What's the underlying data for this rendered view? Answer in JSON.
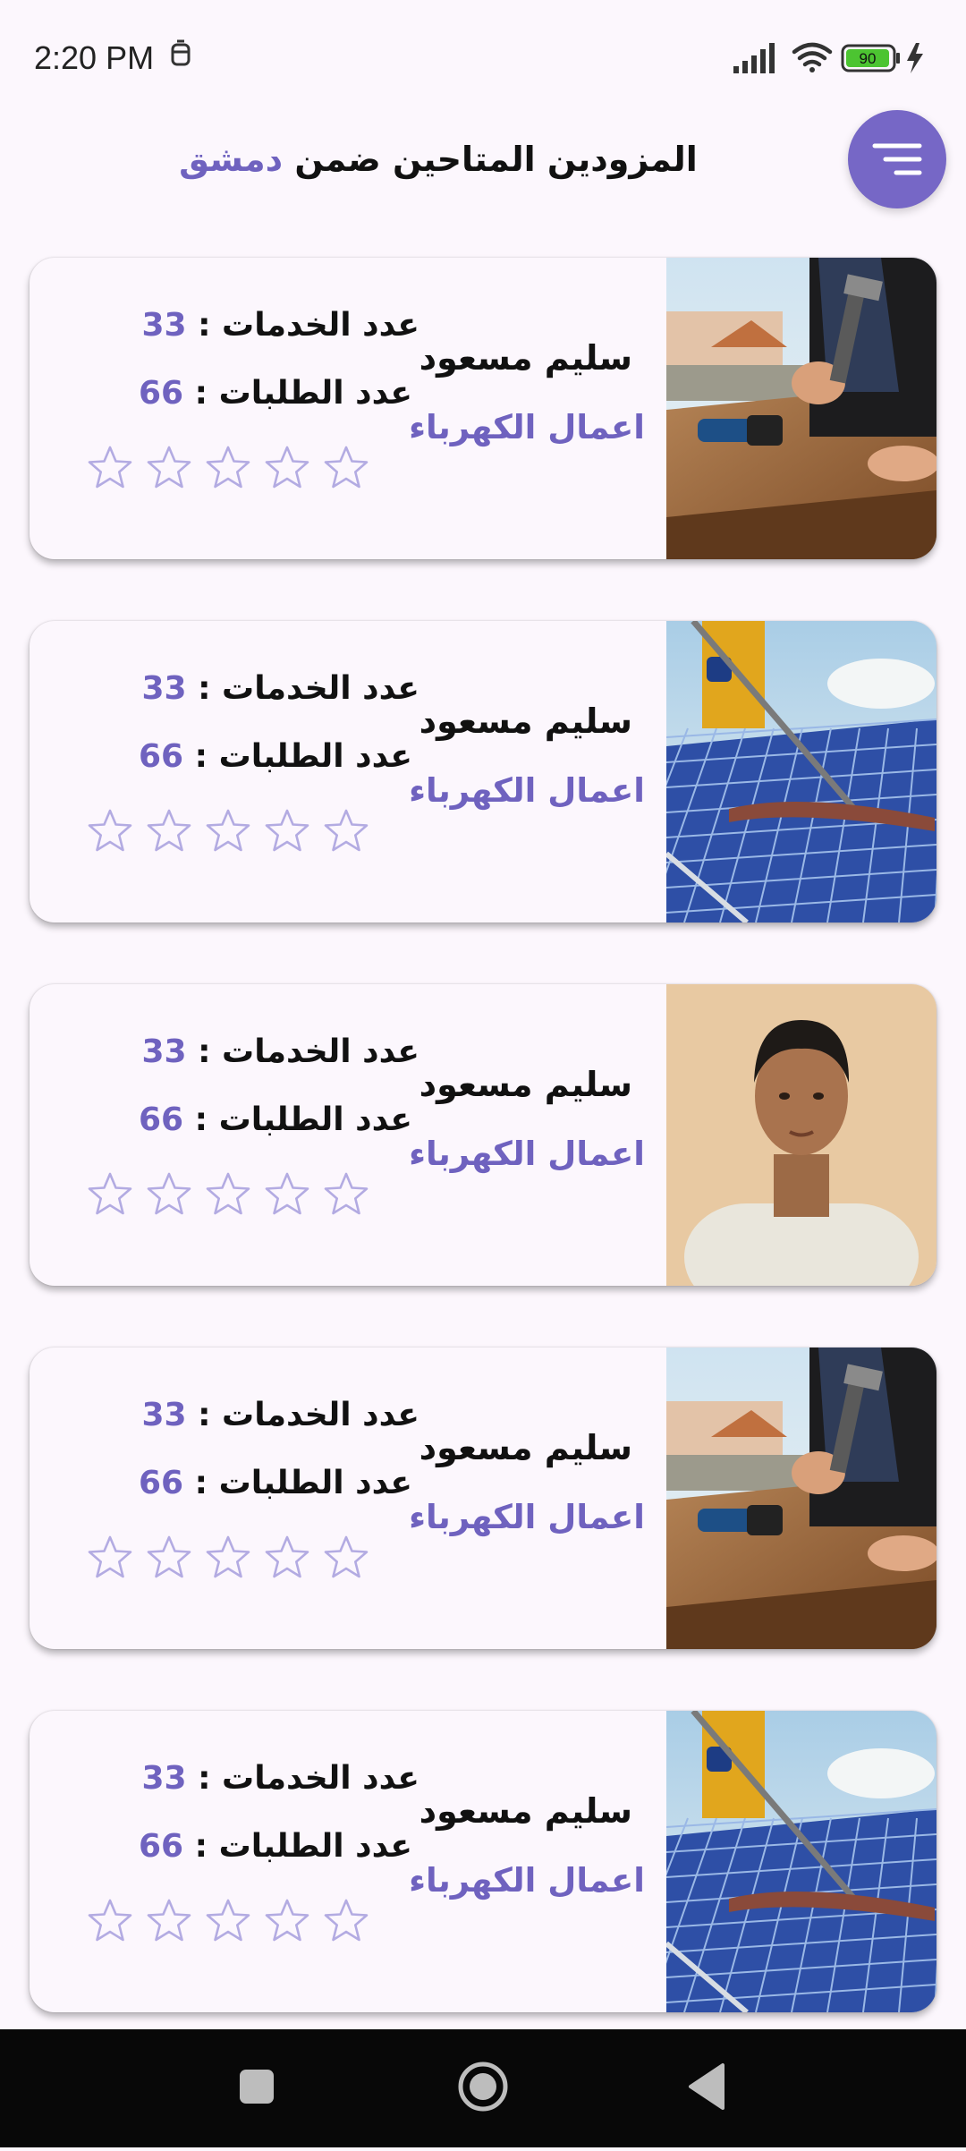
{
  "status_bar": {
    "time": "2:20 PM",
    "battery": "90"
  },
  "header": {
    "title_prefix": "المزودين المتاحين ضمن",
    "city": "دمشق",
    "filter_icon": "filter-lines-icon"
  },
  "providers": [
    {
      "name": "سليم مسعود",
      "category": "اعمال الكهرباء",
      "services_label": "عدد الخدمات :",
      "services_count": "33",
      "requests_label": "عدد الطلبات :",
      "requests_count": "66",
      "rating": 0,
      "photo": "worker-hammer-photo"
    },
    {
      "name": "سليم مسعود",
      "category": "اعمال الكهرباء",
      "services_label": "عدد الخدمات :",
      "services_count": "33",
      "requests_label": "عدد الطلبات :",
      "requests_count": "66",
      "rating": 0,
      "photo": "solar-panel-cleaning-photo"
    },
    {
      "name": "سليم مسعود",
      "category": "اعمال الكهرباء",
      "services_label": "عدد الخدمات :",
      "services_count": "33",
      "requests_label": "عدد الطلبات :",
      "requests_count": "66",
      "rating": 0,
      "photo": "young-man-portrait-photo"
    },
    {
      "name": "سليم مسعود",
      "category": "اعمال الكهرباء",
      "services_label": "عدد الخدمات :",
      "services_count": "33",
      "requests_label": "عدد الطلبات :",
      "requests_count": "66",
      "rating": 0,
      "photo": "worker-hammer-photo"
    },
    {
      "name": "سليم مسعود",
      "category": "اعمال الكهرباء",
      "services_label": "عدد الخدمات :",
      "services_count": "33",
      "requests_label": "عدد الطلبات :",
      "requests_count": "66",
      "rating": 0,
      "photo": "solar-panel-cleaning-photo"
    }
  ],
  "colors": {
    "accent": "#6f62bf",
    "button": "#7667c6",
    "star_outline": "#b3abe2",
    "background": "#fcf7fd"
  }
}
